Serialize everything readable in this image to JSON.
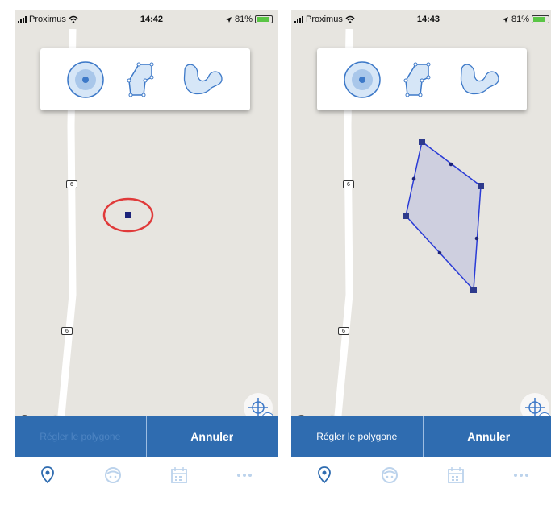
{
  "screens": [
    {
      "status": {
        "carrier": "Proximus",
        "time": "14:42",
        "battery": "81%"
      },
      "road_labels": [
        "6",
        "6"
      ],
      "mapbox_text": "mapbox",
      "info_glyph": "i",
      "tools": [
        "point-tool-icon",
        "polygon-tool-icon",
        "freehand-tool-icon"
      ],
      "action_left": "Régler le polygone",
      "action_left_enabled": false,
      "action_right": "Annuler",
      "tabs": [
        "map-pin-icon",
        "face-icon",
        "calendar-icon",
        "more-icon"
      ],
      "highlight_color": "#e03a3a"
    },
    {
      "status": {
        "carrier": "Proximus",
        "time": "14:43",
        "battery": "81%"
      },
      "road_labels": [
        "6",
        "6"
      ],
      "mapbox_text": "mapbox",
      "info_glyph": "i",
      "tools": [
        "point-tool-icon",
        "polygon-tool-icon",
        "freehand-tool-icon"
      ],
      "action_left": "Régler le polygone",
      "action_left_enabled": true,
      "action_right": "Annuler",
      "tabs": [
        "map-pin-icon",
        "face-icon",
        "calendar-icon",
        "more-icon"
      ],
      "polygon_color": "#2a3bd6"
    }
  ],
  "colors": {
    "accent": "#2f6cb0",
    "tool_fill": "#d6e6f7",
    "tool_stroke": "#3d79c8",
    "marker": "#1c237a"
  }
}
